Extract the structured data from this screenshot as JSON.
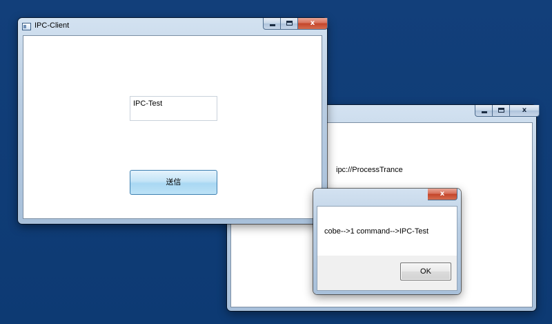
{
  "client_window": {
    "title": "IPC-Client",
    "textbox_value": "IPC-Test",
    "send_button_label": "送信",
    "close_glyph": "x"
  },
  "server_window": {
    "url_text": "ipc://ProcessTrance",
    "close_glyph": "x"
  },
  "message_box": {
    "message": "cobe-->1 command-->IPC-Test",
    "ok_label": "OK",
    "close_glyph": "x"
  },
  "colors": {
    "desktop": "#0f3d78",
    "close_button": "#c4442a",
    "send_button": "#a9d8f3"
  },
  "icons": [
    "window-icon",
    "minimize-icon",
    "maximize-icon",
    "close-icon"
  ]
}
